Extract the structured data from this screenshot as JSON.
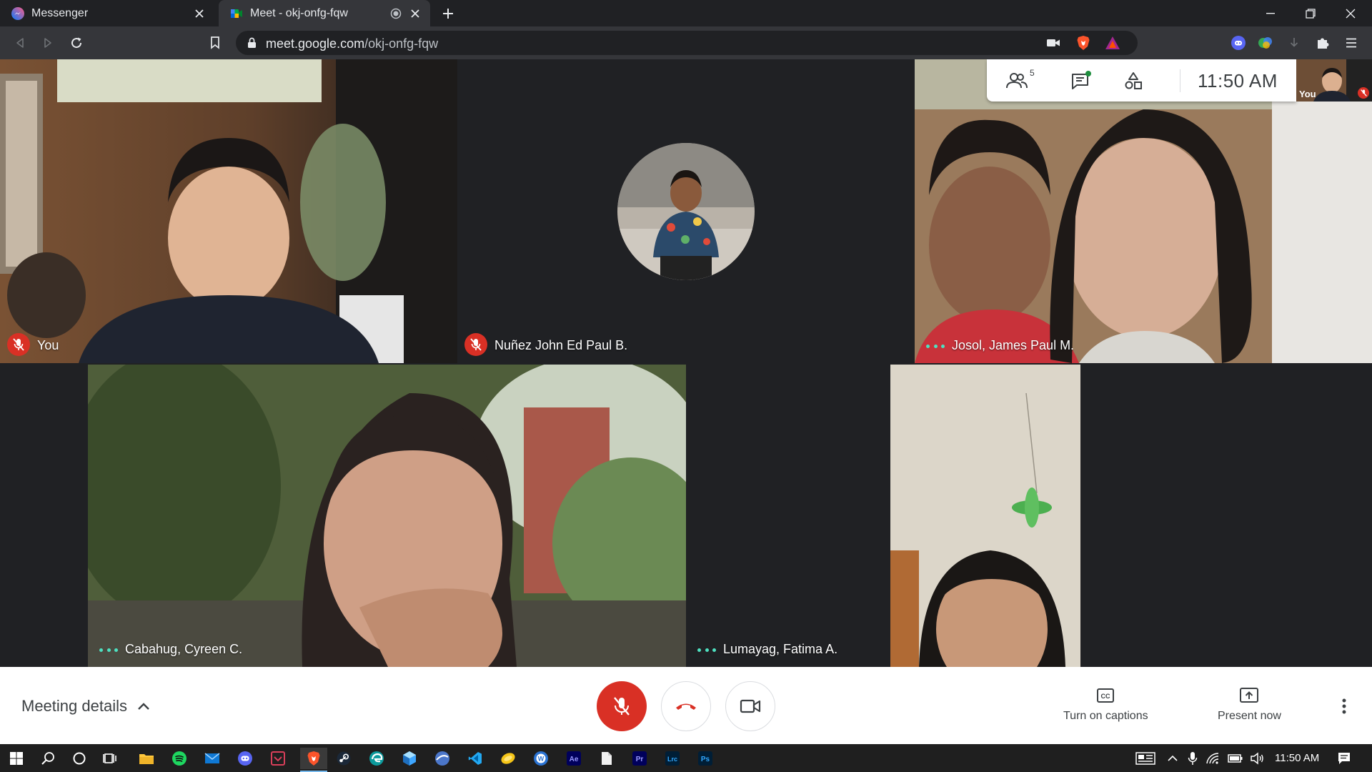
{
  "browser": {
    "tabs": [
      {
        "title": "Messenger",
        "active": false
      },
      {
        "title": "Meet - okj-onfg-fqw",
        "active": true
      }
    ],
    "url_host": "meet.google.com",
    "url_path": "/okj-onfg-fqw"
  },
  "meet": {
    "participant_count": "5",
    "clock": "11:50  AM",
    "self_preview_label": "You",
    "participants": [
      {
        "name": "You",
        "status": "muted"
      },
      {
        "name": "Nuñez John Ed Paul B.",
        "status": "muted"
      },
      {
        "name": "Josol, James Paul M.",
        "status": "speaking-indicator"
      },
      {
        "name": "Cabahug, Cyreen C.",
        "status": "speaking-indicator"
      },
      {
        "name": "Lumayag, Fatima A.",
        "status": "speaking-indicator"
      }
    ]
  },
  "controls": {
    "meeting_details": "Meeting details",
    "captions": "Turn on captions",
    "present": "Present now"
  },
  "taskbar": {
    "time": "11:50 AM"
  },
  "colors": {
    "stage_bg": "#202124",
    "mute_red": "#d93025",
    "speaking_teal": "#4ee1c1"
  }
}
